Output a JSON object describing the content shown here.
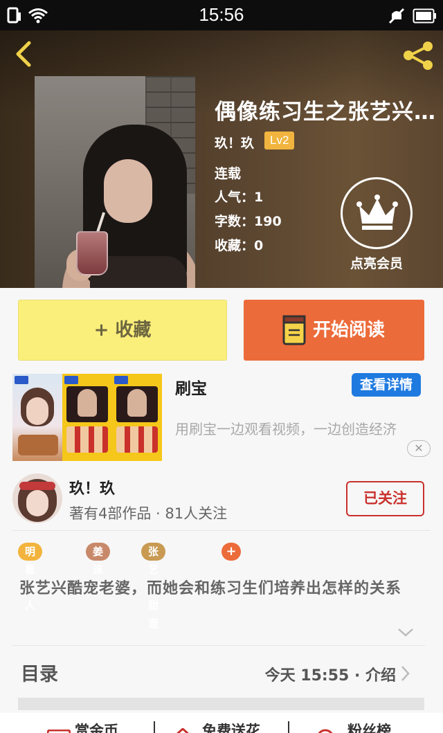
{
  "status_bar": {
    "time": "15:56"
  },
  "book": {
    "title": "偶像练习生之张艺兴…",
    "author": "玖！玖",
    "level": "Lv2",
    "status": "连载",
    "popularity": "人气：1",
    "word_count": "字数：190",
    "favorites": "收藏：0",
    "vip_label": "点亮会员"
  },
  "actions": {
    "favorite": "+ 收藏",
    "read": "开始阅读"
  },
  "ad": {
    "title": "刷宝",
    "detail_button": "查看详情",
    "description": "用刷宝一边观看视频，一边创造经济",
    "close": "✕"
  },
  "author_info": {
    "name": "玖！玖",
    "meta": "著有4部作品 · 81人关注",
    "follow_button": "已关注"
  },
  "tags": [
    "明星同人",
    "姜沫碎",
    "张艺兴甜宠",
    "+"
  ],
  "synopsis": "张艺兴酷宠老婆，而她会和练习生们培养出怎样的关系",
  "toc": {
    "title": "目录",
    "update": "今天 15:55 · 介绍"
  },
  "bottom_bar": {
    "item1": "赏金币",
    "item2": "免费送花",
    "item3": "粉丝榜"
  },
  "colors": {
    "accent_orange": "#ec6b3a",
    "favorite_yellow": "#fbef7b",
    "level_badge": "#f1b53f",
    "follow_red": "#c9302c",
    "ad_blue": "#1f7ae0"
  }
}
